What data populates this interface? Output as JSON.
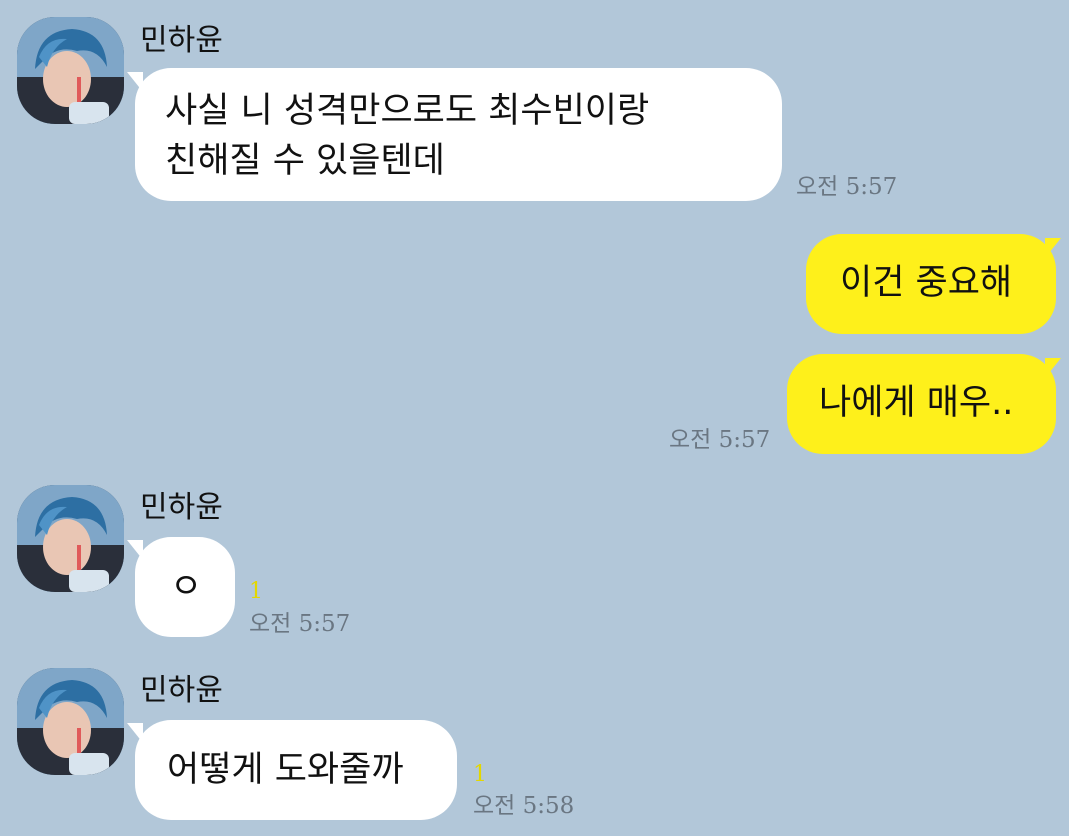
{
  "messages": [
    {
      "sender": "민하윤",
      "avatar": "profile-photo",
      "lines": [
        "사실 니 성격만으로도 최수빈이랑",
        "친해질 수 있을텐데"
      ],
      "time": "오전 5:57"
    },
    {
      "lines": [
        "이건 중요해"
      ]
    },
    {
      "lines": [
        "나에게 매우.."
      ],
      "time": "오전 5:57"
    },
    {
      "sender": "민하윤",
      "avatar": "profile-photo",
      "lines": [
        "ㅇ"
      ],
      "unread": "1",
      "time": "오전 5:57"
    },
    {
      "sender": "민하윤",
      "avatar": "profile-photo",
      "lines": [
        "어떻게 도와줄까"
      ],
      "unread": "1",
      "time": "오전 5:58"
    }
  ],
  "colors": {
    "background": "#b2c7d9",
    "incoming_bubble": "#ffffff",
    "outgoing_bubble": "#fef01b",
    "unread_count": "#e3d700",
    "timestamp": "#6a7682"
  }
}
